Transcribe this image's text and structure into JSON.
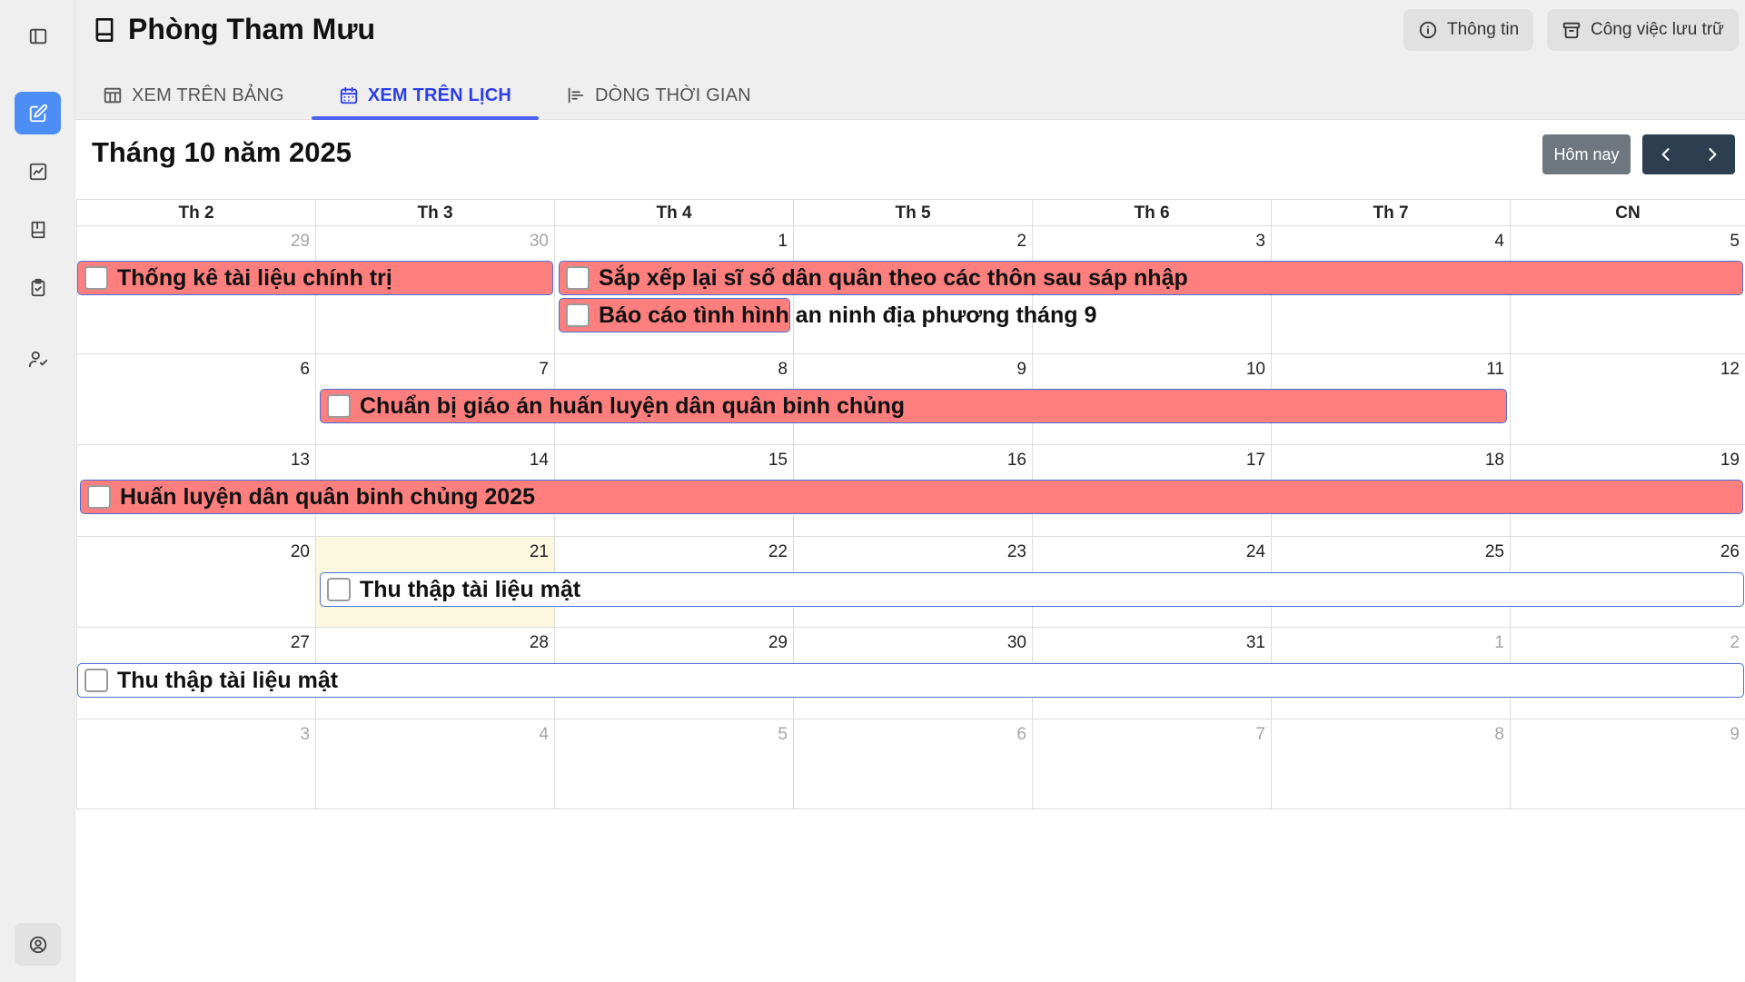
{
  "sidebar": {
    "items": [
      {
        "name": "sidebar-toggle",
        "icon": "sidebar-panel-icon"
      },
      {
        "name": "edit",
        "icon": "edit-icon",
        "active": true
      },
      {
        "name": "chart",
        "icon": "chart-line-icon"
      },
      {
        "name": "book",
        "icon": "book-icon"
      },
      {
        "name": "clipboard",
        "icon": "clipboard-check-icon"
      },
      {
        "name": "user-check",
        "icon": "user-check-icon"
      },
      {
        "name": "profile",
        "icon": "user-circle-icon"
      }
    ]
  },
  "header": {
    "title": "Phòng Tham Mưu",
    "info_label": "Thông tin",
    "archive_label": "Công việc lưu trữ",
    "tabs": [
      {
        "label": "XEM TRÊN BẢNG",
        "icon": "table-icon",
        "active": false
      },
      {
        "label": "XEM TRÊN LỊCH",
        "icon": "calendar-icon",
        "active": true
      },
      {
        "label": "DÒNG THỜI GIAN",
        "icon": "timeline-icon",
        "active": false
      }
    ]
  },
  "calendar": {
    "month_title": "Tháng 10 năm 2025",
    "today_label": "Hôm nay",
    "weekdays": [
      "Th 2",
      "Th 3",
      "Th 4",
      "Th 5",
      "Th 6",
      "Th 7",
      "CN"
    ],
    "weeks": [
      [
        "29",
        "30",
        "1",
        "2",
        "3",
        "4",
        "5"
      ],
      [
        "6",
        "7",
        "8",
        "9",
        "10",
        "11",
        "12"
      ],
      [
        "13",
        "14",
        "15",
        "16",
        "17",
        "18",
        "19"
      ],
      [
        "20",
        "21",
        "22",
        "23",
        "24",
        "25",
        "26"
      ],
      [
        "27",
        "28",
        "29",
        "30",
        "31",
        "1",
        "2"
      ],
      [
        "3",
        "4",
        "5",
        "6",
        "7",
        "8",
        "9"
      ]
    ],
    "events": [
      {
        "title": "Thống kê tài liệu chính trị",
        "color": "#ff7f7f",
        "checked": false
      },
      {
        "title": "Sắp xếp lại sĩ số dân quân theo các thôn sau sáp nhập",
        "color": "#ff7f7f",
        "checked": false
      },
      {
        "title": "Báo cáo tình hình an ninh địa phương tháng 9",
        "color": "#ff7f7f",
        "checked": false
      },
      {
        "title": "Chuẩn bị giáo án huấn luyện dân quân binh chủng",
        "color": "#ff7f7f",
        "checked": false
      },
      {
        "title": "Huấn luyện dân quân binh chủng 2025",
        "color": "#ff7f7f",
        "checked": false
      },
      {
        "title": "Thu thập tài liệu mật",
        "color": "#ffffff",
        "checked": false
      },
      {
        "title": "Thu thập tài liệu mật",
        "color": "#ffffff",
        "checked": false
      }
    ]
  },
  "colors": {
    "accent": "#4c8df6",
    "tab_active": "#2c3ee6",
    "event_red": "#ff7f7f",
    "today_highlight": "#fcf8e0",
    "nav_dark": "#2c3e50"
  }
}
